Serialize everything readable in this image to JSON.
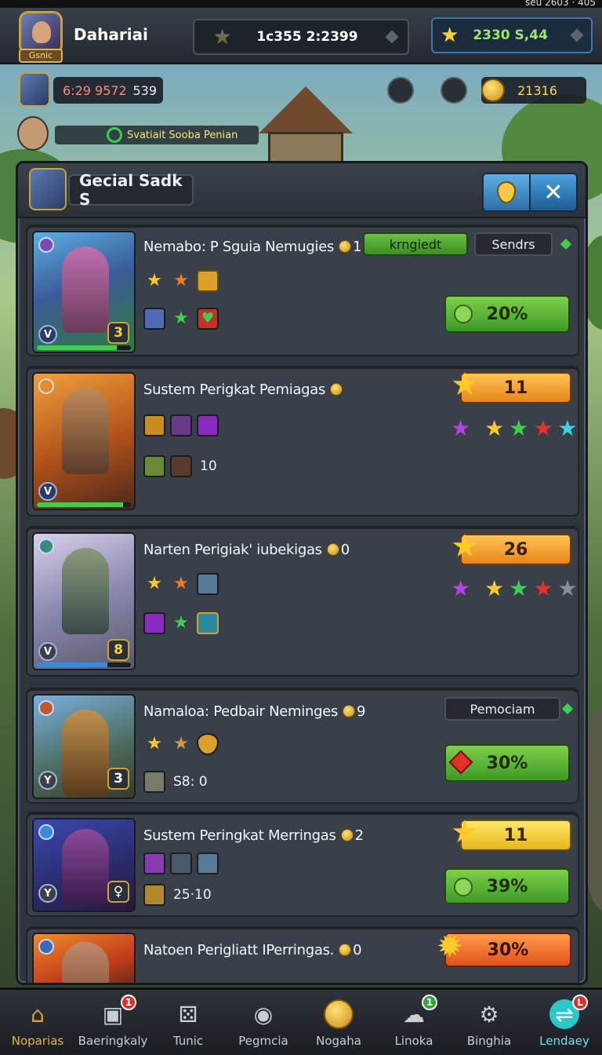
{
  "status_bar": {
    "text": "seu 2603 · 405"
  },
  "header": {
    "player_name": "Dahariai",
    "avatar_label": "Gsnic",
    "center_pill_value": "1c355 2:2399",
    "right_pill_value": "2330 S,44"
  },
  "resources": {
    "values_left": "6:29 9572",
    "values_right": "539",
    "coin_value": "21316"
  },
  "news": {
    "text": "Svatiait Sooba Penian"
  },
  "panel": {
    "title": "Gecial Sadk S"
  },
  "cards": [
    {
      "title": "Nemabo: P Sguia Nemugies",
      "coin_count": "1",
      "level": "3",
      "tag_primary": "krngiedt",
      "tag_secondary": "Sendrs",
      "button_label": "20%"
    },
    {
      "title": "Sustem Perigkat Pemiagas",
      "coin_count": "",
      "level": "",
      "amount": "10",
      "bar_label": "11"
    },
    {
      "title": "Narten Perigiak' iubekigas",
      "coin_count": "0",
      "level": "8",
      "bar_label": "26"
    },
    {
      "title": "Namaloa: Pedbair Neminges",
      "coin_count": "9",
      "level": "3",
      "amount": "S8: 0",
      "tag_secondary": "Pemociam",
      "button_label": "30%"
    },
    {
      "title": "Sustem Peringkat Merringas",
      "coin_count": "2",
      "level": "",
      "amount": "25·10",
      "bar_label": "11",
      "button_label": "39%"
    },
    {
      "title": "Natoen Perigliatt IPerringas.",
      "coin_count": "0",
      "button_label": "30%"
    }
  ],
  "bottom_nav": [
    {
      "label": "Noparias",
      "icon": "home-icon",
      "badge": ""
    },
    {
      "label": "Baeringkaly",
      "icon": "box-icon",
      "badge": "1"
    },
    {
      "label": "Tunic",
      "icon": "dice-icon",
      "badge": ""
    },
    {
      "label": "Pegmcia",
      "icon": "globe-icon",
      "badge": ""
    },
    {
      "label": "Nogaha",
      "icon": "coin-icon",
      "badge": ""
    },
    {
      "label": "Linoka",
      "icon": "chat-icon",
      "badge": "1"
    },
    {
      "label": "Binghia",
      "icon": "gear-icon",
      "badge": ""
    },
    {
      "label": "Lendaey",
      "icon": "shop-icon",
      "badge": "L"
    }
  ],
  "colors": {
    "accent_green": "#3d9a26",
    "accent_orange": "#e8861a",
    "accent_blue": "#2c6fa6",
    "badge_red": "#e0302a",
    "badge_green": "#2ca83a"
  }
}
